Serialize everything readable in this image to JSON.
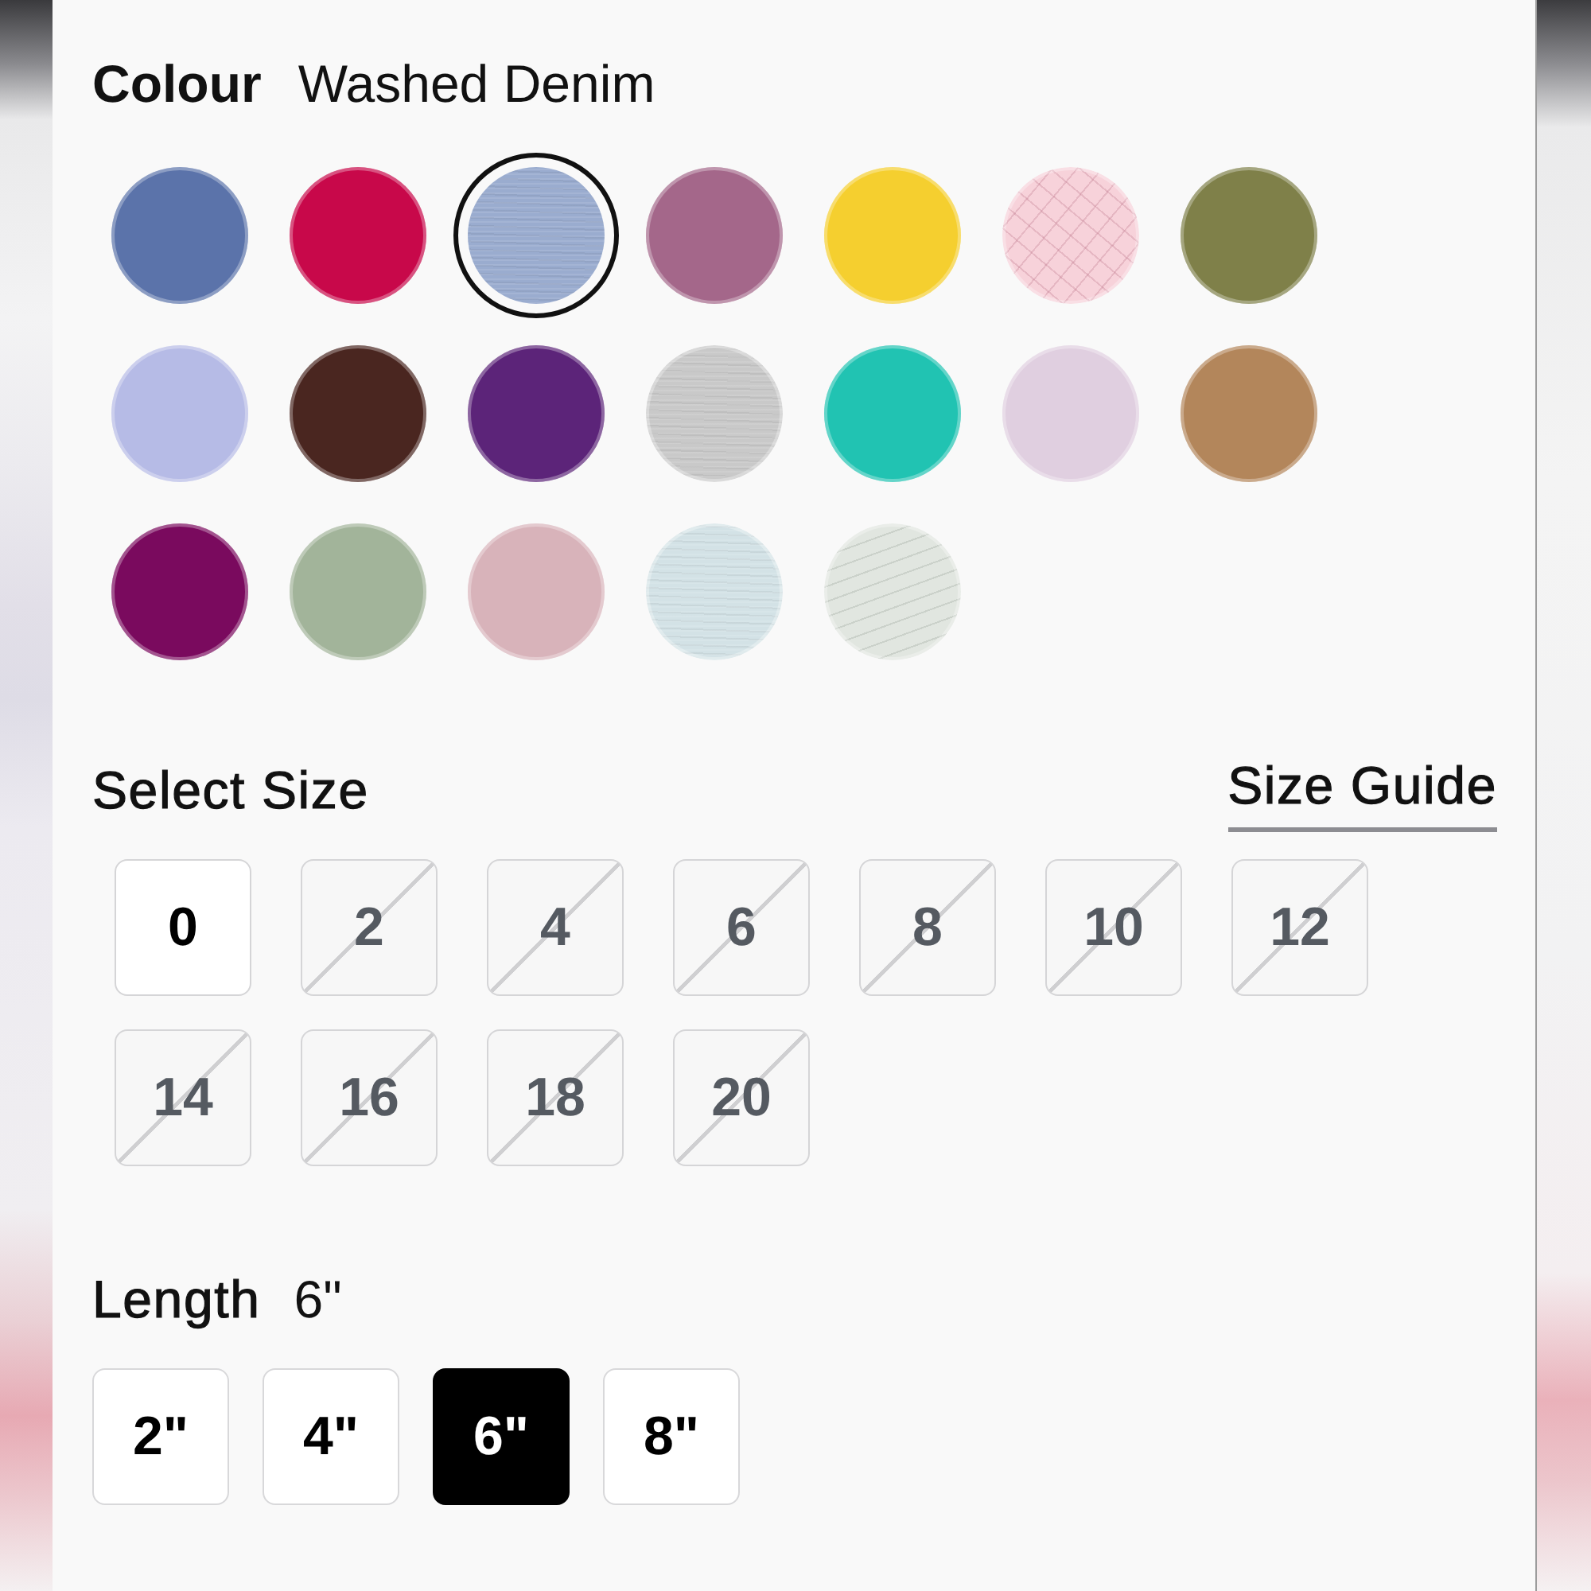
{
  "colour": {
    "label": "Colour",
    "value": "Washed Denim",
    "swatches": [
      {
        "color": "#5b73aa",
        "kind": "solid",
        "selected": false
      },
      {
        "color": "#c8084a",
        "kind": "solid",
        "selected": false
      },
      {
        "color": "#9aaccf",
        "kind": "heather",
        "selected": true
      },
      {
        "color": "#a4678a",
        "kind": "solid",
        "selected": false
      },
      {
        "color": "#f5cf2f",
        "kind": "solid",
        "selected": false
      },
      {
        "color": "#f7d2da",
        "kind": "grid",
        "selected": false
      },
      {
        "color": "#7f8049",
        "kind": "solid",
        "selected": false
      },
      {
        "color": "#b6bbe6",
        "kind": "solid",
        "selected": false
      },
      {
        "color": "#4a2620",
        "kind": "solid",
        "selected": false
      },
      {
        "color": "#5c2479",
        "kind": "solid",
        "selected": false
      },
      {
        "color": "#c9c9c9",
        "kind": "heather",
        "selected": false
      },
      {
        "color": "#21c3b2",
        "kind": "solid",
        "selected": false
      },
      {
        "color": "#e0cfe0",
        "kind": "solid",
        "selected": false
      },
      {
        "color": "#b3865b",
        "kind": "solid",
        "selected": false
      },
      {
        "color": "#7a0a5e",
        "kind": "solid",
        "selected": false
      },
      {
        "color": "#a2b49a",
        "kind": "solid",
        "selected": false
      },
      {
        "color": "#d8b3ba",
        "kind": "solid",
        "selected": false
      },
      {
        "color": "#d3e2e6",
        "kind": "heather",
        "selected": false
      },
      {
        "color": "#e1e6e0",
        "kind": "dotted",
        "selected": false
      }
    ]
  },
  "size": {
    "label": "Select Size",
    "guide_link": "Size Guide",
    "options": [
      {
        "label": "0",
        "available": true
      },
      {
        "label": "2",
        "available": false
      },
      {
        "label": "4",
        "available": false
      },
      {
        "label": "6",
        "available": false
      },
      {
        "label": "8",
        "available": false
      },
      {
        "label": "10",
        "available": false
      },
      {
        "label": "12",
        "available": false
      },
      {
        "label": "14",
        "available": false
      },
      {
        "label": "16",
        "available": false
      },
      {
        "label": "18",
        "available": false
      },
      {
        "label": "20",
        "available": false
      }
    ]
  },
  "length": {
    "label": "Length",
    "value": "6\"",
    "options": [
      {
        "label": "2\"",
        "selected": false
      },
      {
        "label": "4\"",
        "selected": false
      },
      {
        "label": "6\"",
        "selected": true
      },
      {
        "label": "8\"",
        "selected": false
      }
    ]
  }
}
